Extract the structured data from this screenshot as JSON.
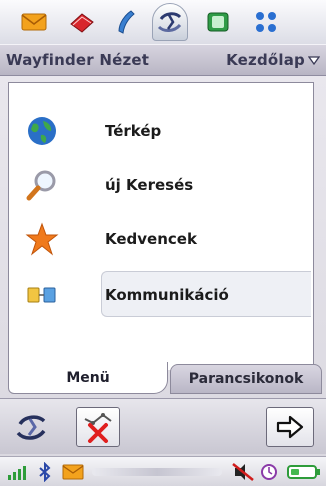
{
  "apps_bar": {
    "items": [
      {
        "icon": "envelope-icon"
      },
      {
        "icon": "book-icon"
      },
      {
        "icon": "phone-handset-icon"
      },
      {
        "icon": "wayfinder-icon",
        "active": true
      },
      {
        "icon": "media-icon"
      },
      {
        "icon": "grid-icon"
      }
    ]
  },
  "title_bar": {
    "title": "Wayfinder Nézet",
    "view_label": "Kezdőlap",
    "dropdown_icon": "triangle-down-icon"
  },
  "menu": {
    "items": [
      {
        "label": "Térkép",
        "icon": "globe-icon"
      },
      {
        "label": "új Keresés",
        "icon": "magnifier-icon"
      },
      {
        "label": "Kedvencek",
        "icon": "star-icon"
      },
      {
        "label": "Kommunikáció",
        "icon": "communication-icon",
        "selected": true
      }
    ]
  },
  "tabs": {
    "active": "Menü",
    "inactive": "Parancsikonok"
  },
  "softkeys": {
    "left_icon": "wayfinder-icon",
    "center_icon": "disconnect-icon",
    "right_icon": "arrow-right-icon"
  },
  "status_bar": {
    "icons": [
      "signal-icon",
      "bluetooth-icon",
      "message-icon",
      "silent-icon",
      "clock-icon",
      "battery-icon"
    ]
  },
  "colors": {
    "accent": "#3a3a55",
    "selection": "#eef0f5",
    "star": "#f07a1c"
  }
}
